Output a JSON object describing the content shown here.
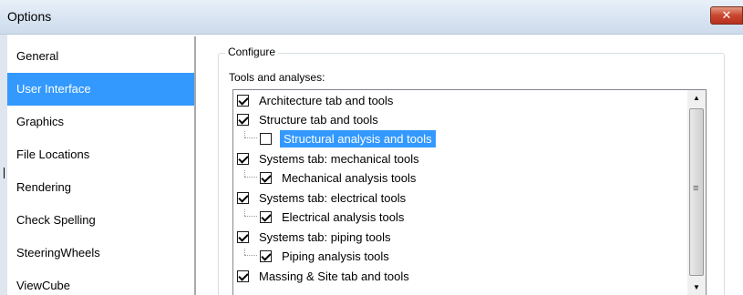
{
  "window": {
    "title": "Options",
    "close_symbol": "✕"
  },
  "categories": [
    {
      "label": "General",
      "selected": false
    },
    {
      "label": "User Interface",
      "selected": true
    },
    {
      "label": "Graphics",
      "selected": false
    },
    {
      "label": "File Locations",
      "selected": false
    },
    {
      "label": "Rendering",
      "selected": false
    },
    {
      "label": "Check Spelling",
      "selected": false
    },
    {
      "label": "SteeringWheels",
      "selected": false
    },
    {
      "label": "ViewCube",
      "selected": false
    }
  ],
  "configure": {
    "group_title": "Configure",
    "tools_label": "Tools and analyses:",
    "items": [
      {
        "label": "Architecture tab and tools",
        "checked": true,
        "child": false,
        "selected": false
      },
      {
        "label": "Structure tab and tools",
        "checked": true,
        "child": false,
        "selected": false
      },
      {
        "label": "Structural analysis and tools",
        "checked": false,
        "child": true,
        "selected": true
      },
      {
        "label": "Systems tab: mechanical tools",
        "checked": true,
        "child": false,
        "selected": false
      },
      {
        "label": "Mechanical analysis tools",
        "checked": true,
        "child": true,
        "selected": false
      },
      {
        "label": "Systems tab: electrical tools",
        "checked": true,
        "child": false,
        "selected": false
      },
      {
        "label": "Electrical analysis tools",
        "checked": true,
        "child": true,
        "selected": false
      },
      {
        "label": "Systems tab: piping tools",
        "checked": true,
        "child": false,
        "selected": false
      },
      {
        "label": "Piping analysis tools",
        "checked": true,
        "child": true,
        "selected": false
      },
      {
        "label": "Massing & Site tab and tools",
        "checked": true,
        "child": false,
        "selected": false
      }
    ]
  },
  "scrollbar": {
    "up_symbol": "▲",
    "down_symbol": "▼",
    "grip_symbol": "≡"
  },
  "icons": {
    "close": "close-icon",
    "scroll_up": "arrow-up-icon",
    "scroll_down": "arrow-down-icon",
    "grip": "grip-icon"
  }
}
